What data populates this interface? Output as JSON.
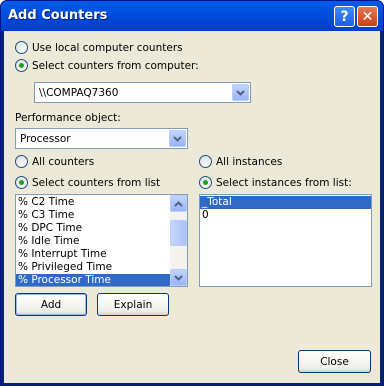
{
  "window": {
    "title": "Add Counters",
    "help_glyph": "?",
    "close_glyph": "✕"
  },
  "computer": {
    "use_local_label": "Use local computer counters",
    "select_from_label": "Select counters from computer:",
    "selected_mode": "select_from",
    "computer_value": "\\\\COMPAQ7360"
  },
  "performance_object": {
    "label": "Performance object:",
    "value": "Processor"
  },
  "counters": {
    "all_label": "All counters",
    "select_list_label": "Select counters from list",
    "selected_mode": "select_list",
    "items": [
      "% C2 Time",
      "% C3 Time",
      "% DPC Time",
      "% Idle Time",
      "% Interrupt Time",
      "% Privileged Time",
      "% Processor Time"
    ],
    "selected_item": "% Processor Time"
  },
  "instances": {
    "all_label": "All instances",
    "select_list_label": "Select instances from list:",
    "selected_mode": "select_list",
    "items": [
      "_Total",
      "0"
    ],
    "selected_item": "_Total"
  },
  "buttons": {
    "add": "Add",
    "explain": "Explain",
    "close": "Close"
  },
  "colors": {
    "selection": "#316ac5",
    "dialog_bg": "#ece9d8",
    "titlebar": "#0055e5"
  },
  "icons": {
    "dropdown": "chevron-down-icon",
    "scroll_up": "scroll-up-icon",
    "scroll_down": "scroll-down-icon"
  }
}
